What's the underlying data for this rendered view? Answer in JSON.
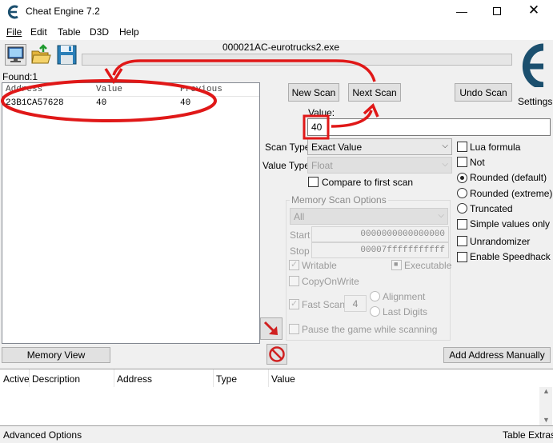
{
  "window": {
    "title": "Cheat Engine 7.2",
    "process": "000021AC-eurotrucks2.exe",
    "found": "Found:1",
    "settings_label": "Settings"
  },
  "menu": [
    "File",
    "Edit",
    "Table",
    "D3D",
    "Help"
  ],
  "results": {
    "columns": [
      "Address",
      "Value",
      "Previous"
    ],
    "rows": [
      {
        "address": "23B1CA57628",
        "value": "40",
        "previous": "40"
      }
    ]
  },
  "scan": {
    "new_scan": "New Scan",
    "next_scan": "Next Scan",
    "undo_scan": "Undo Scan",
    "value_label": "Value:",
    "value": "40",
    "scan_type_label": "Scan Type",
    "scan_type": "Exact Value",
    "value_type_label": "Value Type",
    "value_type": "Float",
    "compare_first": "Compare to first scan"
  },
  "options": {
    "lua_formula": "Lua formula",
    "not": "Not",
    "rounded_default": "Rounded (default)",
    "rounded_extreme": "Rounded (extreme)",
    "truncated": "Truncated",
    "simple_values": "Simple values only",
    "unrandomizer": "Unrandomizer",
    "speedhack": "Enable Speedhack"
  },
  "memory": {
    "title": "Memory Scan Options",
    "region": "All",
    "start_label": "Start",
    "start": "0000000000000000",
    "stop_label": "Stop",
    "stop": "00007fffffffffff",
    "writable": "Writable",
    "executable": "Executable",
    "copy_on_write": "CopyOnWrite",
    "fast_scan": "Fast Scan",
    "fast_value": "4",
    "alignment": "Alignment",
    "last_digits": "Last Digits",
    "pause": "Pause the game while scanning"
  },
  "bottom": {
    "memory_view": "Memory View",
    "add_address": "Add Address Manually",
    "columns": [
      "Active",
      "Description",
      "Address",
      "Type",
      "Value"
    ],
    "advanced": "Advanced Options",
    "table_extras": "Table Extras"
  },
  "colors": {
    "annotation_red": "#e01818",
    "background": "#f0f0f0",
    "button_face": "#e1e1e1"
  }
}
